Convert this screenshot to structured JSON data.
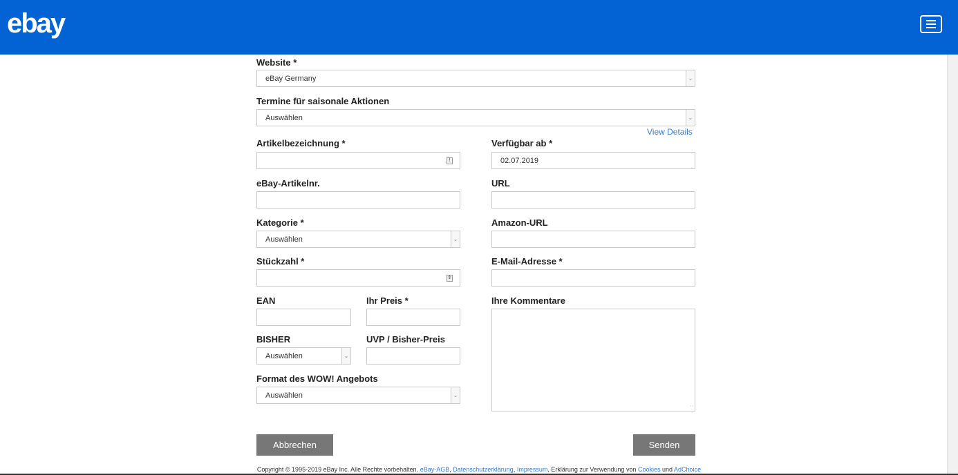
{
  "header": {
    "logo": "ebay",
    "menu_icon": "hamburger-menu-icon"
  },
  "colors": {
    "header_bg": "#0363d4",
    "button_bg": "#777777",
    "link": "#3a7cc7"
  },
  "form": {
    "website": {
      "label": "Website *",
      "value": "eBay Germany"
    },
    "termine": {
      "label": "Termine für saisonale Aktionen",
      "value": "Auswählen",
      "view_details": "View Details"
    },
    "artikelbezeichnung": {
      "label": "Artikelbezeichnung *",
      "value": ""
    },
    "verfuegbar_ab": {
      "label": "Verfügbar ab *",
      "value": "02.07.2019"
    },
    "artikelnr": {
      "label": "eBay-Artikelnr.",
      "value": ""
    },
    "url": {
      "label": "URL",
      "value": ""
    },
    "kategorie": {
      "label": "Kategorie *",
      "value": "Auswählen"
    },
    "amazon_url": {
      "label": "Amazon-URL",
      "value": ""
    },
    "stueckzahl": {
      "label": "Stückzahl *",
      "value": ""
    },
    "email": {
      "label": "E-Mail-Adresse *",
      "value": ""
    },
    "ean": {
      "label": "EAN",
      "value": ""
    },
    "ihr_preis": {
      "label": "Ihr Preis *",
      "value": ""
    },
    "kommentare": {
      "label": "Ihre Kommentare",
      "value": ""
    },
    "bisher": {
      "label": "BISHER",
      "value": "Auswählen"
    },
    "uvp": {
      "label": "UVP / Bisher-Preis",
      "value": ""
    },
    "format": {
      "label": "Format des WOW! Angebots",
      "value": "Auswählen"
    }
  },
  "buttons": {
    "cancel": "Abbrechen",
    "submit": "Senden"
  },
  "footer": {
    "copyright": "Copyright © 1995-2019 eBay Inc. Alle Rechte vorbehalten.",
    "agb": "eBay-AGB",
    "sep1": ",",
    "datenschutz": "Datenschutzerklärung",
    "sep2": ",",
    "impressum": "Impressum",
    "erklaerung": ", Erklärung zur Verwendung von",
    "cookies": "Cookies",
    "und": "und",
    "adchoice": "AdChoice"
  }
}
